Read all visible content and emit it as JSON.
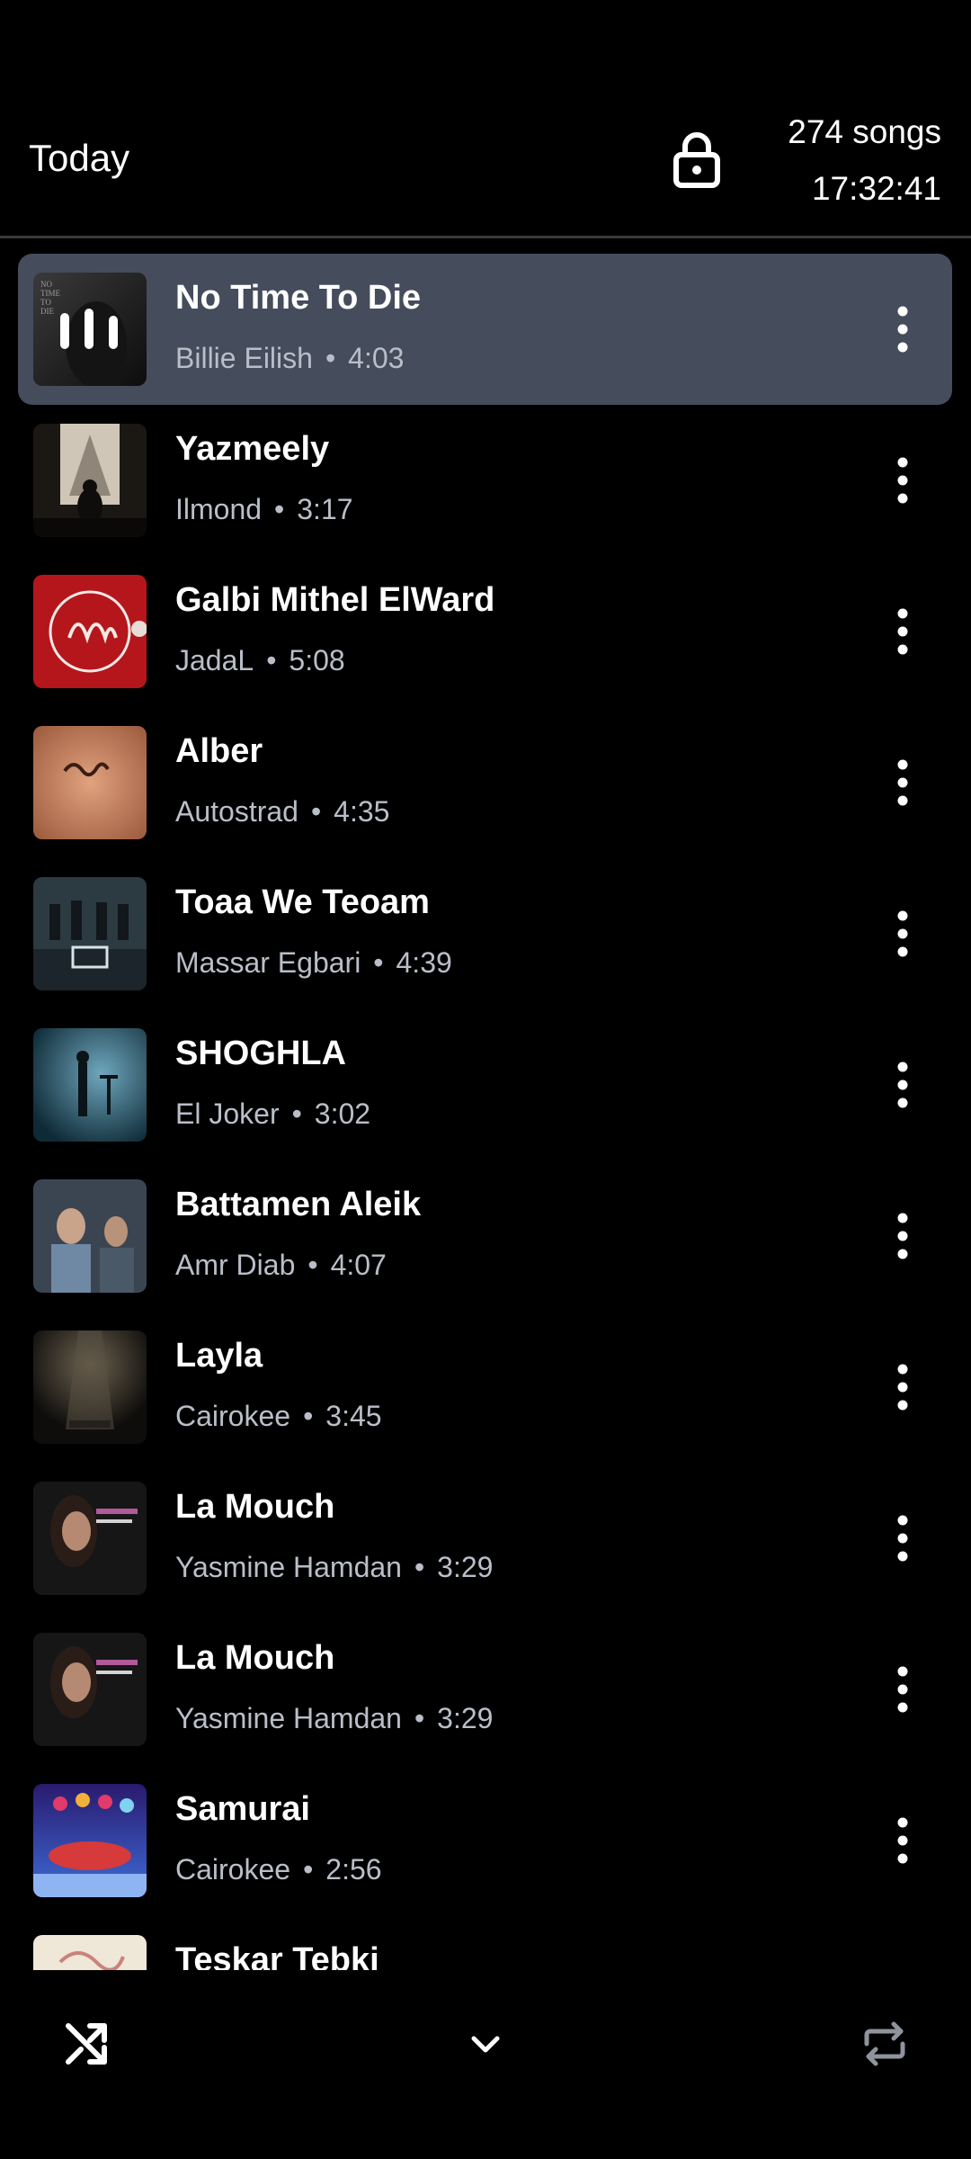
{
  "header": {
    "title": "Today",
    "song_count": "274 songs",
    "clock": "17:32:41"
  },
  "songs": [
    {
      "title": "No Time To Die",
      "artist": "Billie Eilish",
      "duration": "4:03",
      "active": true
    },
    {
      "title": "Yazmeely",
      "artist": "Ilmond",
      "duration": "3:17"
    },
    {
      "title": "Galbi Mithel ElWard",
      "artist": "JadaL",
      "duration": "5:08"
    },
    {
      "title": "Alber",
      "artist": "Autostrad",
      "duration": "4:35"
    },
    {
      "title": "Toaa We Teoam",
      "artist": "Massar Egbari",
      "duration": "4:39"
    },
    {
      "title": "SHOGHLA",
      "artist": "El Joker",
      "duration": "3:02"
    },
    {
      "title": "Battamen Aleik",
      "artist": "Amr Diab",
      "duration": "4:07"
    },
    {
      "title": "Layla",
      "artist": "Cairokee",
      "duration": "3:45"
    },
    {
      "title": "La Mouch",
      "artist": "Yasmine Hamdan",
      "duration": "3:29"
    },
    {
      "title": "La Mouch",
      "artist": "Yasmine Hamdan",
      "duration": "3:29"
    },
    {
      "title": "Samurai",
      "artist": "Cairokee",
      "duration": "2:56"
    },
    {
      "title": "Teskar Tebki",
      "artist": "",
      "duration": ""
    }
  ],
  "meta_separator": "•",
  "icons": {
    "lock": "lock-icon",
    "more": "more-vertical-icon",
    "shuffle": "shuffle-icon",
    "collapse": "chevron-down-icon",
    "repeat": "repeat-icon",
    "playing": "playing-bars-icon"
  },
  "colors": {
    "background": "#000000",
    "active_row": "#454c5c",
    "secondary_text": "#b9bec8",
    "repeat_inactive": "#8e939c"
  }
}
